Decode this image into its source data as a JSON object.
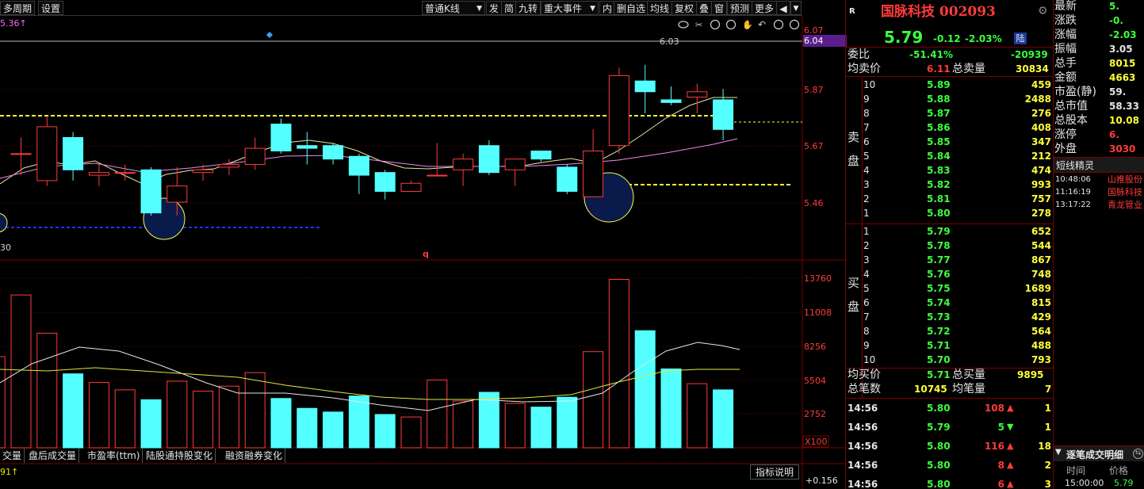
{
  "toolbar": {
    "left_items": [
      "多周期",
      "设置"
    ],
    "kline_type": "普通K线",
    "right_items": [
      "发",
      "简",
      "九转",
      "重大事件",
      "内",
      "删自选",
      "均线",
      "复权",
      "叠",
      "窗",
      "预测",
      "更多"
    ]
  },
  "chart": {
    "ma_label": "5.36↑",
    "high_marker": "6.03",
    "low_label": "30",
    "q_label": "q",
    "price_axis": [
      "6.07",
      "6.04",
      "5.87",
      "5.67",
      "5.46"
    ],
    "volume_axis": [
      "13760",
      "11008",
      "8256",
      "5504",
      "2752",
      "X100"
    ],
    "indicator_label": "91↑",
    "indicator_value": "+0.156",
    "indicator_button": "指标说明",
    "bottom_tabs": [
      "交量",
      "盘后成交量",
      "市盈率(ttm)",
      "陆股通持股变化",
      "融资融券变化"
    ],
    "chart_data": {
      "type": "candlestick",
      "candles": [
        {
          "open": 5.7,
          "close": 5.7,
          "high": 5.76,
          "low": 5.62
        },
        {
          "open": 5.6,
          "close": 5.8,
          "high": 5.84,
          "low": 5.58
        },
        {
          "open": 5.76,
          "close": 5.64,
          "high": 5.78,
          "low": 5.6
        },
        {
          "open": 5.62,
          "close": 5.63,
          "high": 5.66,
          "low": 5.58
        },
        {
          "open": 5.63,
          "close": 5.63,
          "high": 5.66,
          "low": 5.6
        },
        {
          "open": 5.64,
          "close": 5.48,
          "high": 5.65,
          "low": 5.47
        },
        {
          "open": 5.52,
          "close": 5.58,
          "high": 5.65,
          "low": 5.47
        },
        {
          "open": 5.63,
          "close": 5.64,
          "high": 5.66,
          "low": 5.6
        },
        {
          "open": 5.65,
          "close": 5.66,
          "high": 5.68,
          "low": 5.62
        },
        {
          "open": 5.66,
          "close": 5.72,
          "high": 5.76,
          "low": 5.64
        },
        {
          "open": 5.81,
          "close": 5.71,
          "high": 5.83,
          "low": 5.7
        },
        {
          "open": 5.73,
          "close": 5.72,
          "high": 5.78,
          "low": 5.66
        },
        {
          "open": 5.73,
          "close": 5.68,
          "high": 5.74,
          "low": 5.66
        },
        {
          "open": 5.69,
          "close": 5.62,
          "high": 5.7,
          "low": 5.55
        },
        {
          "open": 5.63,
          "close": 5.56,
          "high": 5.64,
          "low": 5.53
        },
        {
          "open": 5.56,
          "close": 5.59,
          "high": 5.6,
          "low": 5.56
        },
        {
          "open": 5.62,
          "close": 5.62,
          "high": 5.74,
          "low": 5.62
        },
        {
          "open": 5.64,
          "close": 5.68,
          "high": 5.7,
          "low": 5.58
        },
        {
          "open": 5.73,
          "close": 5.63,
          "high": 5.75,
          "low": 5.62
        },
        {
          "open": 5.64,
          "close": 5.68,
          "high": 5.68,
          "low": 5.58
        },
        {
          "open": 5.71,
          "close": 5.68,
          "high": 5.71,
          "low": 5.67
        },
        {
          "open": 5.65,
          "close": 5.56,
          "high": 5.66,
          "low": 5.55
        },
        {
          "open": 5.54,
          "close": 5.71,
          "high": 5.79,
          "low": 5.54
        },
        {
          "open": 5.73,
          "close": 5.99,
          "high": 6.02,
          "low": 5.7
        },
        {
          "open": 5.97,
          "close": 5.93,
          "high": 6.03,
          "low": 5.85
        },
        {
          "open": 5.9,
          "close": 5.89,
          "high": 5.95,
          "low": 5.88
        },
        {
          "open": 5.91,
          "close": 5.93,
          "high": 5.96,
          "low": 5.85
        },
        {
          "open": 5.9,
          "close": 5.79,
          "high": 5.94,
          "low": 5.75
        }
      ],
      "volumes": [
        7400,
        12400,
        9300,
        6000,
        5300,
        4700,
        3900,
        5400,
        4600,
        5000,
        6100,
        4000,
        3200,
        2900,
        4200,
        2700,
        2500,
        5500,
        3800,
        4500,
        3600,
        3300,
        4100,
        7800,
        13660,
        9500,
        6400,
        5200,
        4700
      ],
      "ylim": [
        5.32,
        6.1
      ],
      "vol_ylim": [
        0,
        13760
      ]
    }
  },
  "quote": {
    "flag": "R",
    "name": "国脉科技 002093",
    "price": "5.79",
    "change": "-0.12",
    "change_pct": "-2.03%",
    "tag": "陆",
    "weibi_label": "委比",
    "weibi_pct": "-51.41%",
    "weibi_diff": "-20939",
    "avg_sell_label": "均卖价",
    "avg_sell": "6.11",
    "total_sell_label": "总卖量",
    "total_sell": "30834",
    "sell_label": "卖盘",
    "buy_label": "买盘",
    "sells": [
      {
        "lvl": "10",
        "price": "5.89",
        "vol": "459"
      },
      {
        "lvl": "9",
        "price": "5.88",
        "vol": "2488"
      },
      {
        "lvl": "8",
        "price": "5.87",
        "vol": "276"
      },
      {
        "lvl": "7",
        "price": "5.86",
        "vol": "408"
      },
      {
        "lvl": "6",
        "price": "5.85",
        "vol": "347"
      },
      {
        "lvl": "5",
        "price": "5.84",
        "vol": "212"
      },
      {
        "lvl": "4",
        "price": "5.83",
        "vol": "474"
      },
      {
        "lvl": "3",
        "price": "5.82",
        "vol": "993"
      },
      {
        "lvl": "2",
        "price": "5.81",
        "vol": "757"
      },
      {
        "lvl": "1",
        "price": "5.80",
        "vol": "278"
      }
    ],
    "buys": [
      {
        "lvl": "1",
        "price": "5.79",
        "vol": "652"
      },
      {
        "lvl": "2",
        "price": "5.78",
        "vol": "544"
      },
      {
        "lvl": "3",
        "price": "5.77",
        "vol": "867"
      },
      {
        "lvl": "4",
        "price": "5.76",
        "vol": "748"
      },
      {
        "lvl": "5",
        "price": "5.75",
        "vol": "1689"
      },
      {
        "lvl": "6",
        "price": "5.74",
        "vol": "815"
      },
      {
        "lvl": "7",
        "price": "5.73",
        "vol": "429"
      },
      {
        "lvl": "8",
        "price": "5.72",
        "vol": "564"
      },
      {
        "lvl": "9",
        "price": "5.71",
        "vol": "488"
      },
      {
        "lvl": "10",
        "price": "5.70",
        "vol": "793"
      }
    ],
    "avg_buy_label": "均买价",
    "avg_buy": "5.71",
    "total_buy_label": "总买量",
    "total_buy": "9895",
    "total_trades_label": "总笔数",
    "total_trades": "10745",
    "avg_trade_label": "均笔量",
    "avg_trade": "7",
    "ticks": [
      {
        "time": "14:56",
        "price": "5.80",
        "vol": "108",
        "dir": "up",
        "n": "1"
      },
      {
        "time": "14:56",
        "price": "5.79",
        "vol": "5",
        "dir": "down",
        "n": "1"
      },
      {
        "time": "14:56",
        "price": "5.80",
        "vol": "116",
        "dir": "up",
        "n": "18"
      },
      {
        "time": "14:56",
        "price": "5.80",
        "vol": "8",
        "dir": "up",
        "n": "2"
      },
      {
        "time": "14:56",
        "price": "5.80",
        "vol": "6",
        "dir": "up",
        "n": "3"
      }
    ]
  },
  "side": {
    "stats": [
      {
        "label": "最新",
        "value": "5."
      },
      {
        "label": "涨跌",
        "value": "-0."
      },
      {
        "label": "涨幅",
        "value": "-2.03"
      },
      {
        "label": "振幅",
        "value": "3.05"
      },
      {
        "label": "总手",
        "value": "8015"
      },
      {
        "label": "金额",
        "value": "4663"
      },
      {
        "label": "市盈(静)",
        "value": "59."
      },
      {
        "label": "总市值",
        "value": "58.33"
      },
      {
        "label": "总股本",
        "value": "10.08"
      },
      {
        "label": "涨停",
        "value": "6."
      },
      {
        "label": "外盘",
        "value": "3030"
      }
    ],
    "news_title": "短线精灵",
    "news": [
      {
        "time": "10:48:06",
        "text": "山推股份"
      },
      {
        "time": "11:16:19",
        "text": "国脉科技"
      },
      {
        "time": "13:17:22",
        "text": "青龙管业"
      }
    ],
    "detail_title": "逐笔成交明细",
    "detail_cols": [
      "时间",
      "价格"
    ],
    "detail_row": {
      "time": "15:00:00",
      "price": "5.79"
    }
  }
}
